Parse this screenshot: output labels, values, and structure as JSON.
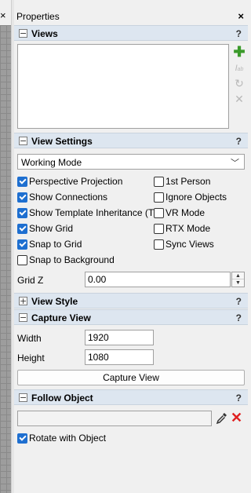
{
  "panel": {
    "title": "Properties",
    "close": "×"
  },
  "left_tab": {
    "close": "×"
  },
  "views": {
    "title": "Views",
    "toggle": "−",
    "help": "?",
    "icons": [
      "add-icon",
      "text-icon",
      "refresh-icon",
      "delete-icon"
    ]
  },
  "view_settings": {
    "title": "View Settings",
    "toggle": "−",
    "help": "?",
    "mode": {
      "value": "Working Mode",
      "options": [
        "Working Mode"
      ]
    },
    "left_options": [
      {
        "label": "Perspective Projection",
        "checked": true
      },
      {
        "label": "Show Connections",
        "checked": true
      },
      {
        "label": "Show Template Inheritance (T)",
        "checked": true
      },
      {
        "label": "Show Grid",
        "checked": true
      },
      {
        "label": "Snap to Grid",
        "checked": true
      },
      {
        "label": "Snap to Background",
        "checked": false
      }
    ],
    "right_options": [
      {
        "label": "1st Person",
        "checked": false
      },
      {
        "label": "Ignore Objects",
        "checked": false
      },
      {
        "label": "VR Mode",
        "checked": false
      },
      {
        "label": "RTX Mode",
        "checked": false
      },
      {
        "label": "Sync Views",
        "checked": false
      }
    ],
    "grid_z": {
      "label": "Grid Z",
      "value": "0.00"
    }
  },
  "view_style": {
    "title": "View Style",
    "toggle": "+",
    "help": "?"
  },
  "capture_view": {
    "title": "Capture View",
    "toggle": "−",
    "help": "?",
    "width": {
      "label": "Width",
      "value": "1920"
    },
    "height": {
      "label": "Height",
      "value": "1080"
    },
    "button": "Capture View"
  },
  "follow_object": {
    "title": "Follow Object",
    "toggle": "−",
    "help": "?",
    "value": "",
    "rotate": {
      "label": "Rotate with Object",
      "checked": true
    }
  },
  "colors": {
    "accent": "#1e6fd0",
    "section_bg": "#dde6f0",
    "delete_red": "#e02020",
    "add_green": "#3a9a2a"
  }
}
